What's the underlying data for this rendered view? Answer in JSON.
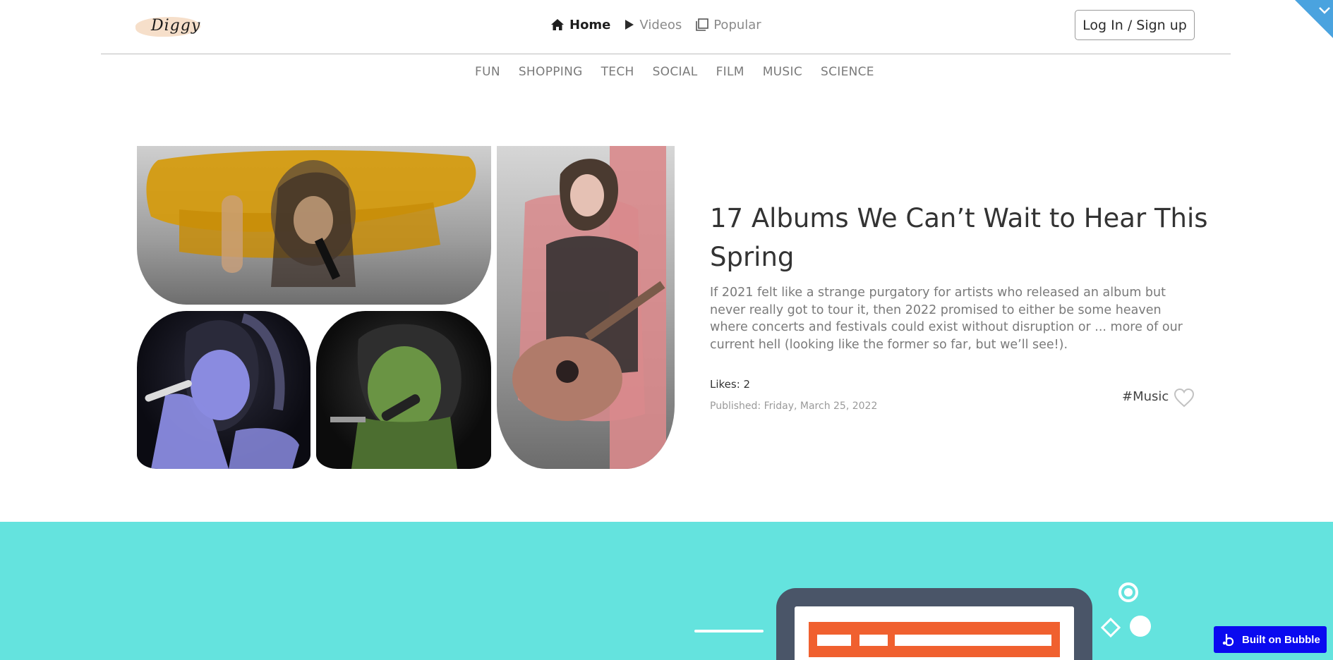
{
  "header": {
    "logo_text": "Diggy",
    "nav": [
      {
        "label": "Home",
        "icon": "home-icon",
        "active": true
      },
      {
        "label": "Videos",
        "icon": "play-icon",
        "active": false
      },
      {
        "label": "Popular",
        "icon": "layers-icon",
        "active": false
      }
    ],
    "login_label": "Log In / Sign up"
  },
  "categories": [
    "FUN",
    "SHOPPING",
    "TECH",
    "SOCIAL",
    "FILM",
    "MUSIC",
    "SCIENCE"
  ],
  "article": {
    "title": "17 Albums We Can’t Wait to Hear This Spring",
    "excerpt": "If 2021 felt like a strange purgatory for artists who released an album but never really got to tour it, then 2022 promised to either be some heaven where concerts and festivals could exist without disruption or ... more of our current hell (looking like the former so far, but we’ll see!).",
    "likes": "Likes: 2",
    "published": "Published: Friday, March 25, 2022",
    "tag": "#Music"
  },
  "badge": {
    "label": "Built on Bubble"
  },
  "colors": {
    "band": "#64e3de",
    "accent_orange": "#f0602f",
    "badge_blue": "#0a0af0",
    "corner_blue": "#4aa3df"
  }
}
